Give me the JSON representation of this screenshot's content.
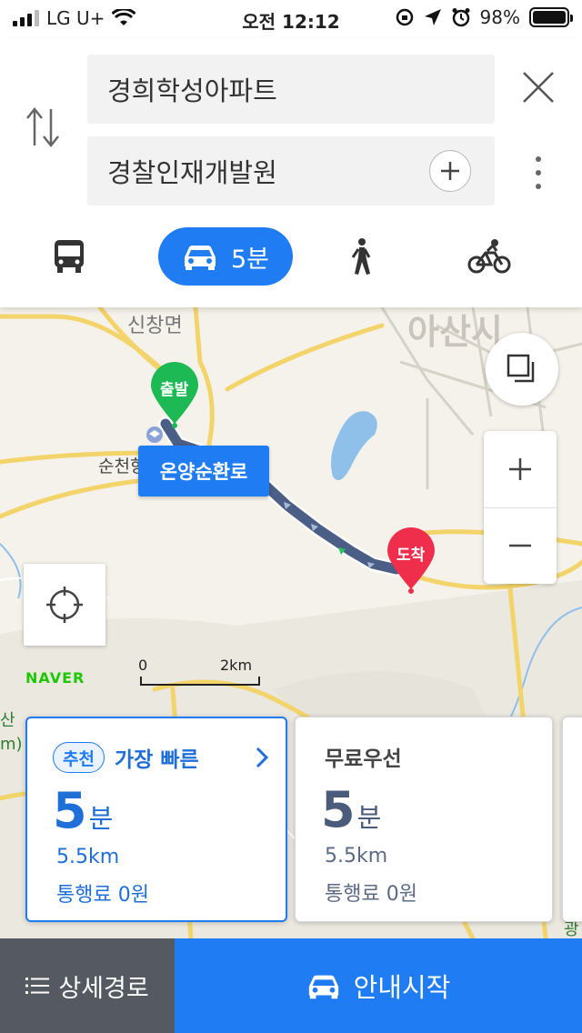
{
  "status_bar": {
    "carrier": "LG U+",
    "time": "오전 12:12",
    "battery": "98%"
  },
  "search": {
    "origin": "경희학성아파트",
    "destination": "경찰인재개발원"
  },
  "modes": {
    "car_time": "5분",
    "selected": "car"
  },
  "map": {
    "road_label": "온양순환로",
    "start_marker": "출발",
    "end_marker": "도착",
    "place_labels": [
      "신창면",
      "아산시",
      "순천향대학교"
    ],
    "scale_start": "0",
    "scale_end": "2km",
    "brand": "NAVER",
    "edge_fragments": [
      "산",
      "m)",
      "광"
    ]
  },
  "routes": [
    {
      "badge": "추천",
      "title": "가장 빠른",
      "time_value": "5",
      "time_unit": "분",
      "distance": "5.5km",
      "toll": "통행료 0원"
    },
    {
      "title": "무료우선",
      "time_value": "5",
      "time_unit": "분",
      "distance": "5.5km",
      "toll": "통행료 0원"
    }
  ],
  "bottom": {
    "details_label": "상세경로",
    "start_label": "안내시작"
  },
  "colors": {
    "accent": "#1f7cf2",
    "start_pin": "#1db954",
    "end_pin": "#ee2e4a",
    "route_line": "#4a5e86",
    "details_bg": "#555a62"
  },
  "icons": [
    "swap-icon",
    "close-icon",
    "add-icon",
    "more-icon",
    "bus-icon",
    "car-icon",
    "walk-icon",
    "bike-icon",
    "layers-icon",
    "zoom-in-icon",
    "zoom-out-icon",
    "locate-icon",
    "chevron-right-icon",
    "list-icon"
  ]
}
